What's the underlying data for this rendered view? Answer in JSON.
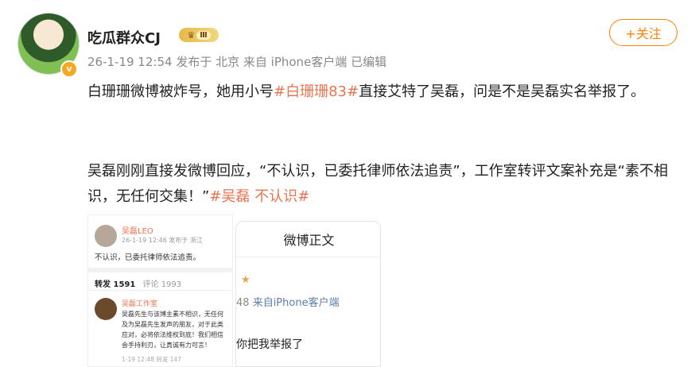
{
  "user": {
    "name": "吃瓜群众CJ",
    "level": "Ⅲ",
    "badge": "v"
  },
  "meta": {
    "date": "26-1-19 12:54",
    "location": "发布于 北京",
    "source": "来自 iPhone客户端",
    "edited": "已编辑"
  },
  "follow_label": "+关注",
  "post": {
    "p1_a": "白珊珊微博被炸号，她用小号",
    "p1_tag": "#白珊珊83#",
    "p1_b": "直接艾特了吴磊，问是不是吴磊实名举报了。",
    "p2_a": "吴磊刚刚直接发微博回应，“不认识，已委托律师依法追责”，工作室转评文案补充是“素不相识，无任何交集！”",
    "p2_tag": "#吴磊 不认识#"
  },
  "image1": {
    "author": "吴磊LEO",
    "date": "26-1-19 12:46  发布于 浙江",
    "text": "不认识，已委托律师依法追责。",
    "tab_repost": "转发 1591",
    "tab_comment": "评论 1993",
    "reply_author": "吴磊工作室",
    "reply_lines": [
      "吴磊先生与该博主素不相识，无任何",
      "及为吴磊先生发声的朋友，对于此类",
      "应对，必将依法维权到底！我们相信",
      "会手持利刃，让真诚有力可言！"
    ],
    "reply_date": "1-19 12:48  转发 147"
  },
  "image2": {
    "header": "微博正文",
    "source_num": "48",
    "source_text": "来自iPhone客户端",
    "body": "你把我举报了"
  }
}
